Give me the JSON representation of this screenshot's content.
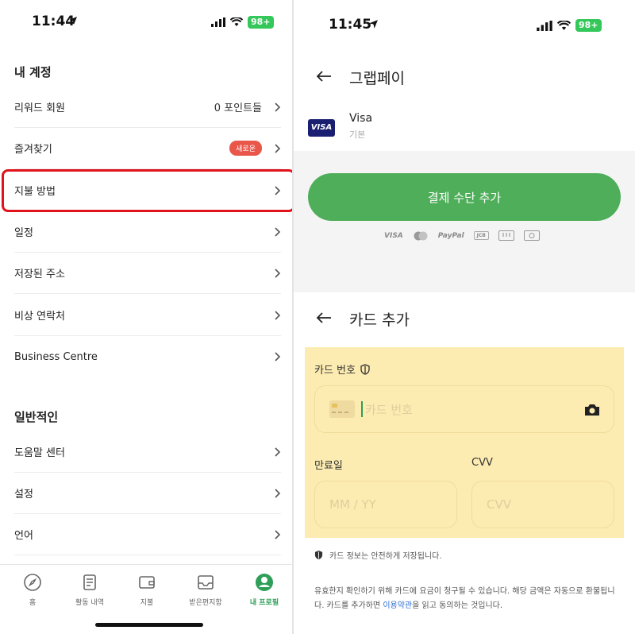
{
  "left_panel": {
    "status_bar": {
      "time": "11:44",
      "battery": "98+"
    },
    "sections": [
      {
        "title": "내 계정"
      },
      {
        "title": "일반적인"
      }
    ],
    "account_items": [
      {
        "label": "리워드 회원",
        "value": "0 포인트들"
      },
      {
        "label": "즐겨찾기",
        "badge": "새로운"
      },
      {
        "label": "지불 방법"
      },
      {
        "label": "일정"
      },
      {
        "label": "저장된 주소"
      },
      {
        "label": "비상 연락처"
      },
      {
        "label": "Business Centre"
      }
    ],
    "general_items": [
      {
        "label": "도움말 센터"
      },
      {
        "label": "설정"
      },
      {
        "label": "언어"
      }
    ],
    "bottom_nav": [
      {
        "label": "홈",
        "icon": "compass-icon"
      },
      {
        "label": "활동 내역",
        "icon": "receipt-icon"
      },
      {
        "label": "지불",
        "icon": "wallet-icon"
      },
      {
        "label": "받은편지함",
        "icon": "inbox-icon"
      },
      {
        "label": "내 프로필",
        "icon": "profile-icon",
        "active": true
      }
    ],
    "accent_color": "#2e9e58",
    "highlight_color": "#e0121b"
  },
  "right_panel": {
    "status_bar": {
      "time": "11:45",
      "battery": "98+"
    },
    "grabpay": {
      "title": "그랩페이",
      "card": {
        "logo_text": "VISA",
        "name": "Visa",
        "sub": "기본"
      },
      "add_button": "결제 수단 추가",
      "brands": [
        "VISA",
        "PayPal",
        "JCB"
      ]
    },
    "add_card": {
      "title": "카드 추가",
      "card_number_label": "카드 번호",
      "card_number_placeholder": "카드 번호",
      "expiry_label": "만료일",
      "expiry_placeholder": "MM / YY",
      "cvv_label": "CVV",
      "cvv_placeholder": "CVV",
      "secure_note": "카드 정보는 안전하게 저장됩니다.",
      "disclaimer_part1": "유효한지 확인하기 위해 카드에 요금이 청구될 수 있습니다. 해당 금액은 자동으로 환불됩니다. 카드를 추가하면 ",
      "terms_link": "이용약관",
      "disclaimer_part2": "을 읽고 동의하는 것입니다."
    },
    "button_color": "#4fae5a",
    "form_highlight_color": "#fdecb1"
  }
}
